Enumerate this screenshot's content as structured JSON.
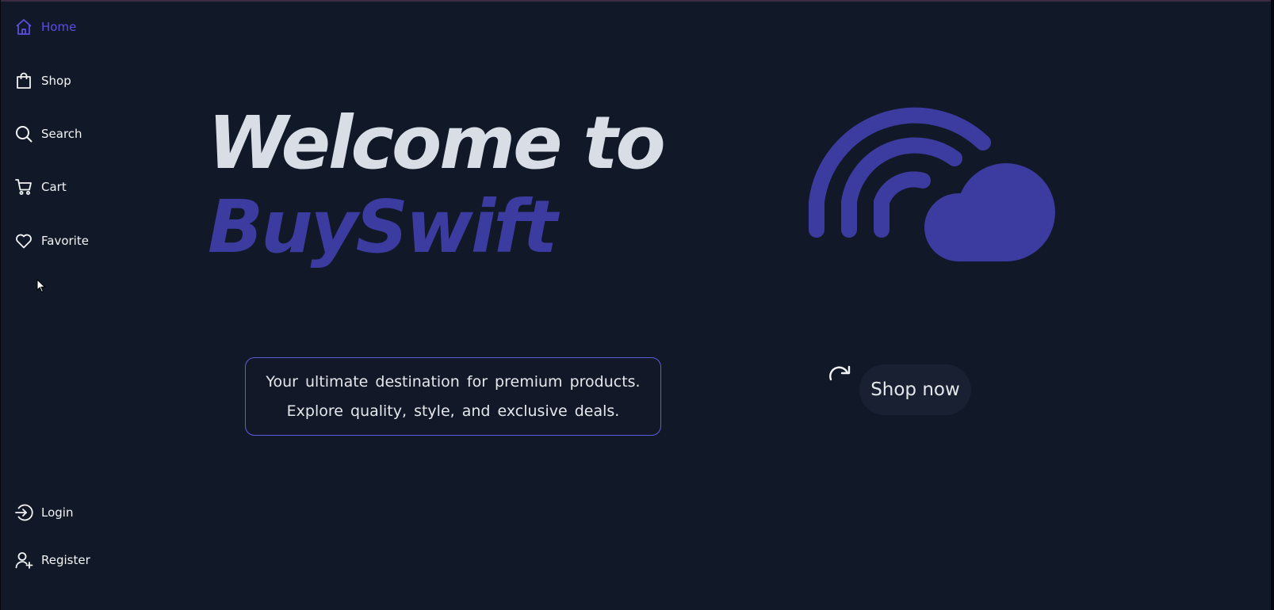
{
  "nav": {
    "home": "Home",
    "shop": "Shop",
    "search": "Search",
    "cart": "Cart",
    "favorite": "Favorite",
    "login": "Login",
    "register": "Register"
  },
  "hero": {
    "line1": "Welcome to",
    "line2": "BuySwift"
  },
  "tagline": {
    "line1": "Your ultimate destination for premium products.",
    "line2": "Explore quality, style, and exclusive deals."
  },
  "cta": {
    "shop_now": "Shop now"
  },
  "colors": {
    "background": "#111827",
    "accent": "#3b3ba0",
    "active_nav": "#5b4fe0",
    "text": "#e5e7eb"
  },
  "icons": [
    "home-icon",
    "shopping-bag-icon",
    "search-icon",
    "cart-icon",
    "heart-icon",
    "login-icon",
    "user-plus-icon",
    "redo-icon",
    "wifi-cloud-logo"
  ]
}
